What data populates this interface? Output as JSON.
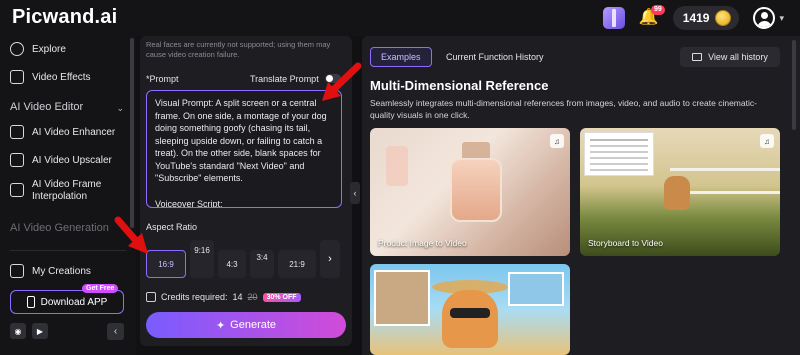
{
  "app": {
    "logo_main": "Picwand",
    "logo_suffix": ".ai"
  },
  "header": {
    "notification_badge": "99",
    "credits": "1419"
  },
  "sidebar": {
    "explore": "Explore",
    "video_effects": "Video Effects",
    "section_editor": "AI Video Editor",
    "enhancer": "AI Video Enhancer",
    "upscaler": "AI Video Upscaler",
    "frame_interp": "AI Video Frame Interpolation",
    "section_generation": "AI Video Generation",
    "my_creations": "My Creations",
    "get_free": "Get Free",
    "download_app": "Download APP"
  },
  "panel": {
    "notice": "Real faces are currently not supported; using them may cause video creation failure.",
    "prompt_label": "*Prompt",
    "translate_label": "Translate Prompt",
    "prompt_text_1": "Visual Prompt: A split screen or a central frame. On one side, a montage of your dog doing something goofy (chasing its tail, sleeping upside down, or failing to catch a treat). On the other side, blank spaces for YouTube's standard \"Next Video\" and \"Subscribe\" elements.",
    "prompt_text_2": "Voiceover Script:",
    "aspect_label": "Aspect Ratio",
    "ratios": [
      "16:9",
      "9:16",
      "4:3",
      "3:4",
      "21:9"
    ],
    "credits_label": "Credits required:",
    "credits_now": "14",
    "credits_old": "20",
    "off_badge": "30% OFF",
    "generate": "Generate"
  },
  "content": {
    "tab_examples": "Examples",
    "tab_history": "Current Function History",
    "view_all": "View all history",
    "title": "Multi-Dimensional Reference",
    "description": "Seamlessly integrates multi-dimensional references from images, video, and audio to create cinematic-quality visuals in one click.",
    "cards": [
      {
        "label": "Product Image to Video"
      },
      {
        "label": "Storyboard to Video"
      },
      {
        "label": ""
      }
    ]
  }
}
